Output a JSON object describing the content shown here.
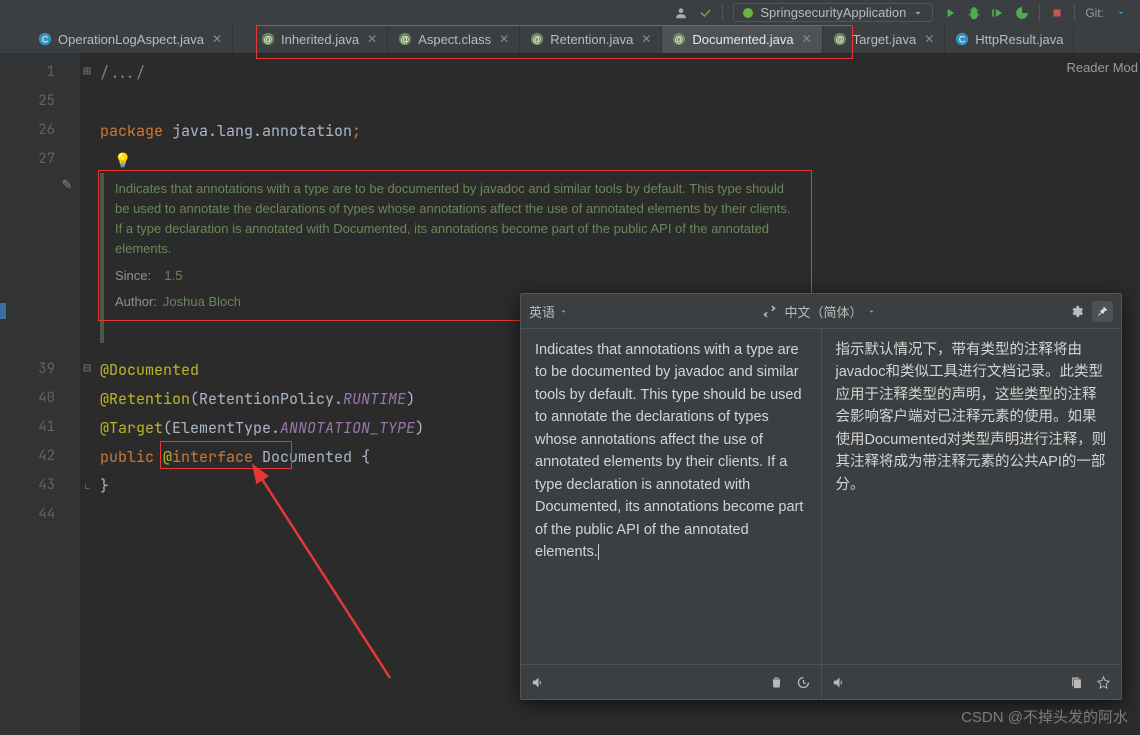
{
  "runbar": {
    "config": "SpringsecurityApplication",
    "git_label": "Git:"
  },
  "tabs": [
    {
      "label": "OperationLogAspect.java",
      "icon": "class",
      "gap": true
    },
    {
      "label": "Inherited.java",
      "icon": "ann"
    },
    {
      "label": "Aspect.class",
      "icon": "ann"
    },
    {
      "label": "Retention.java",
      "icon": "ann"
    },
    {
      "label": "Documented.java",
      "icon": "ann",
      "active": true
    },
    {
      "label": "Target.java",
      "icon": "ann"
    },
    {
      "label": "HttpResult.java",
      "icon": "class"
    }
  ],
  "reader_mode": "Reader Mod",
  "gutter_lines": [
    "1",
    "25",
    "26",
    "27",
    "",
    "",
    "",
    "",
    "",
    "",
    "",
    "39",
    "40",
    "41",
    "42",
    "43",
    "44"
  ],
  "code": {
    "l1_comment": "/.../",
    "pkg_kw": "package ",
    "pkg": "java.lang.annotation",
    "semi": ";",
    "doc_body": "Indicates that annotations with a type are to be documented by javadoc and similar tools by default. This type should be used to annotate the declarations of types whose annotations affect the use of annotated elements by their clients. If a type declaration is annotated with Documented, its annotations become part of the public API of the annotated elements.",
    "since_lbl": "Since:",
    "since_val": "1.5",
    "author_lbl": "Author:",
    "author_val": "Joshua Bloch",
    "ann_doc": "@Documented",
    "ann_ret": "@Retention",
    "ret_arg": "RetentionPolicy.",
    "ret_val": "RUNTIME",
    "ann_tgt": "@Target",
    "tgt_arg": "ElementType.",
    "tgt_val": "ANNOTATION_TYPE",
    "mod": "public ",
    "at": "@",
    "intf_kw": "interface ",
    "type": "Documented",
    "lbr": " {",
    "rbr": "}"
  },
  "translate": {
    "src_lang": "英语",
    "tgt_lang": "中文（简体）",
    "src_text": "Indicates that annotations with a type are to be documented by javadoc and similar tools by default. This type should be used to annotate the declarations of types whose annotations affect the use of annotated elements by their clients. If a type declaration is annotated with Documented, its annotations become part of the public API of the annotated elements.",
    "tgt_text": "指示默认情况下，带有类型的注释将由javadoc和类似工具进行文档记录。此类型应用于注释类型的声明，这些类型的注释会影响客户端对已注释元素的使用。如果使用Documented对类型声明进行注释，则其注释将成为带注释元素的公共API的一部分。"
  },
  "watermark": "CSDN @不掉头发的阿水"
}
